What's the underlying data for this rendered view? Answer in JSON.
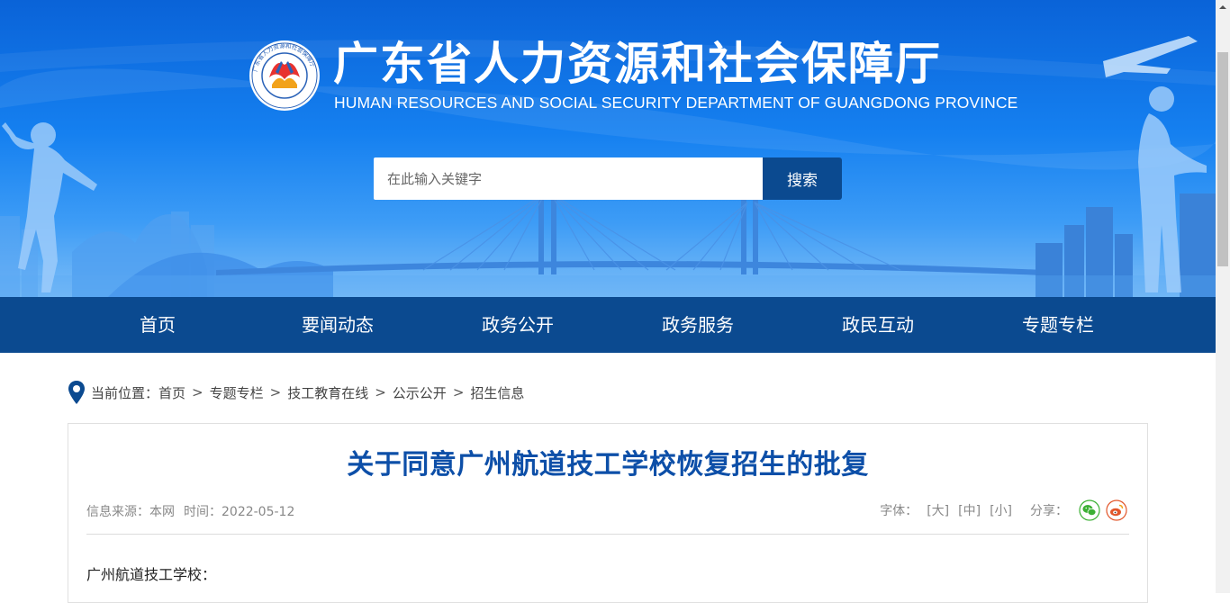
{
  "header": {
    "title": "广东省人力资源和社会保障厅",
    "subtitle": "HUMAN RESOURCES AND SOCIAL SECURITY DEPARTMENT OF GUANGDONG PROVINCE",
    "logo_ring_text": "广东省人力资源和社会保障厅"
  },
  "search": {
    "placeholder": "在此输入关键字",
    "button_label": "搜索"
  },
  "nav": {
    "items": [
      {
        "label": "首页"
      },
      {
        "label": "要闻动态"
      },
      {
        "label": "政务公开"
      },
      {
        "label": "政务服务"
      },
      {
        "label": "政民互动"
      },
      {
        "label": "专题专栏"
      }
    ]
  },
  "breadcrumb": {
    "prefix": "当前位置：",
    "items": [
      "首页",
      "专题专栏",
      "技工教育在线",
      "公示公开",
      "招生信息"
    ],
    "separator": ">"
  },
  "article": {
    "title": "关于同意广州航道技工学校恢复招生的批复",
    "source": "信息来源：本网",
    "time": "时间：2022-05-12",
    "font_label": "字体：",
    "font_large": "[大]",
    "font_medium": "[中]",
    "font_small": "[小]",
    "share_label": "分享：",
    "salutation": "广州航道技工学校："
  },
  "colors": {
    "nav_bg": "#0b4a90",
    "title_blue": "#0d4fa8",
    "banner_blue": "#1580f0",
    "wechat_green": "#3cb034",
    "weibo_orange": "#e2562a"
  },
  "icons": [
    "location-pin-icon",
    "wechat-icon",
    "weibo-icon",
    "logo-emblem"
  ]
}
